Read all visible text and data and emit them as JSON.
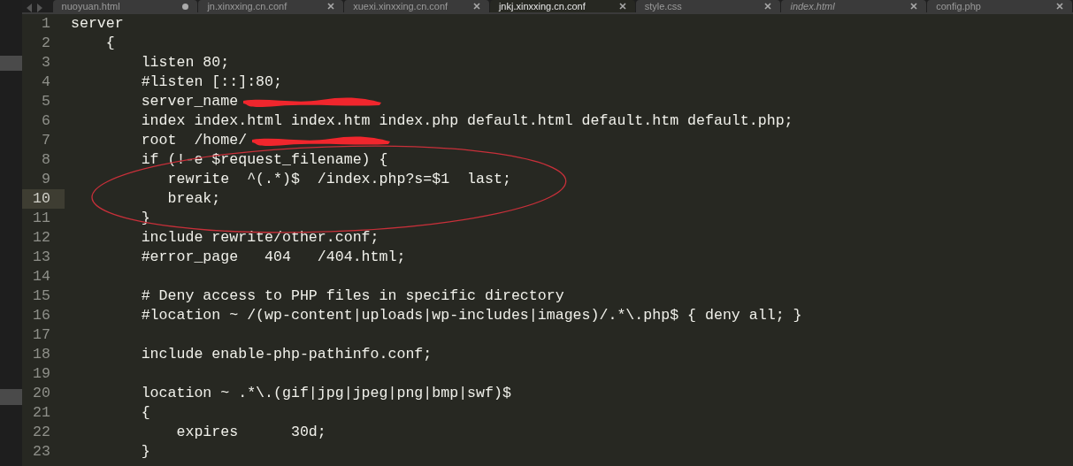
{
  "tabs": [
    {
      "label": "nuoyuan.html",
      "selected": false,
      "modified": true,
      "italic": false
    },
    {
      "label": "jn.xinxxing.cn.conf",
      "selected": false,
      "modified": false,
      "italic": false
    },
    {
      "label": "xuexi.xinxxing.cn.conf",
      "selected": false,
      "modified": false,
      "italic": false
    },
    {
      "label": "jnkj.xinxxing.cn.conf",
      "selected": true,
      "modified": false,
      "italic": false
    },
    {
      "label": "style.css",
      "selected": false,
      "modified": false,
      "italic": false
    },
    {
      "label": "index.html",
      "selected": false,
      "modified": false,
      "italic": true
    },
    {
      "label": "config.php",
      "selected": false,
      "modified": false,
      "italic": false
    }
  ],
  "lines": [
    {
      "number": "1",
      "text": "server",
      "current": false,
      "redacted": false
    },
    {
      "number": "2",
      "text": "    {",
      "current": false,
      "redacted": false
    },
    {
      "number": "3",
      "text": "        listen 80;",
      "current": false,
      "redacted": false
    },
    {
      "number": "4",
      "text": "        #listen [::]:80;",
      "current": false,
      "redacted": false
    },
    {
      "number": "5",
      "text": "        server_name",
      "current": false,
      "redacted": true
    },
    {
      "number": "6",
      "text": "        index index.html index.htm index.php default.html default.htm default.php;",
      "current": false,
      "redacted": false
    },
    {
      "number": "7",
      "text": "        root  /home/",
      "current": false,
      "redacted": true
    },
    {
      "number": "8",
      "text": "        if (!-e $request_filename) {",
      "current": false,
      "redacted": false
    },
    {
      "number": "9",
      "text": "           rewrite  ^(.*)$  /index.php?s=$1  last;",
      "current": false,
      "redacted": false
    },
    {
      "number": "10",
      "text": "           break;",
      "current": true,
      "redacted": false
    },
    {
      "number": "11",
      "text": "        }",
      "current": false,
      "redacted": false
    },
    {
      "number": "12",
      "text": "        include rewrite/other.conf;",
      "current": false,
      "redacted": false
    },
    {
      "number": "13",
      "text": "        #error_page   404   /404.html;",
      "current": false,
      "redacted": false
    },
    {
      "number": "14",
      "current": false,
      "redacted": false
    },
    {
      "number": "15",
      "text": "        # Deny access to PHP files in specific directory",
      "current": false,
      "redacted": false
    },
    {
      "number": "16",
      "text": "        #location ~ /(wp-content|uploads|wp-includes|images)/.*\\.php$ { deny all; }",
      "current": false,
      "redacted": false
    },
    {
      "number": "17",
      "current": false,
      "redacted": false
    },
    {
      "number": "18",
      "text": "        include enable-php-pathinfo.conf;",
      "current": false,
      "redacted": false
    },
    {
      "number": "19",
      "current": false,
      "redacted": false
    },
    {
      "number": "20",
      "text": "        location ~ .*\\.(gif|jpg|jpeg|png|bmp|swf)$",
      "current": false,
      "redacted": false
    },
    {
      "number": "21",
      "text": "        {",
      "current": false,
      "redacted": false
    },
    {
      "number": "22",
      "text": "            expires      30d;",
      "current": false,
      "redacted": false
    },
    {
      "number": "23",
      "text": "        }",
      "current": false,
      "redacted": false
    }
  ]
}
